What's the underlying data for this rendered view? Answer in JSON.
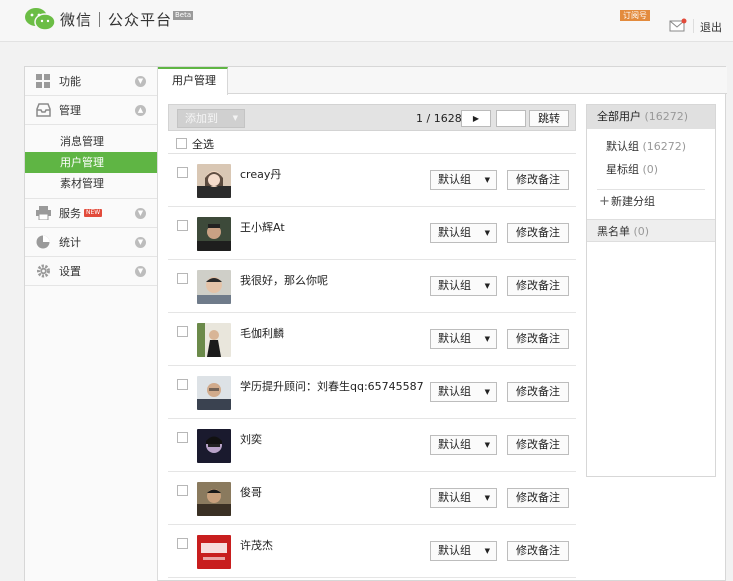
{
  "header": {
    "brand": "微信｜公众平台",
    "beta": "Beta",
    "account_type": "订阅号",
    "logout": "退出"
  },
  "sidebar": {
    "items": [
      {
        "label": "功能",
        "icon": "grid-icon"
      },
      {
        "label": "管理",
        "icon": "inbox-icon"
      },
      {
        "label": "服务",
        "icon": "printer-icon",
        "badge": "NEW"
      },
      {
        "label": "统计",
        "icon": "pie-icon"
      },
      {
        "label": "设置",
        "icon": "gear-icon"
      }
    ],
    "sub_items": [
      {
        "label": "消息管理"
      },
      {
        "label": "用户管理"
      },
      {
        "label": "素材管理"
      }
    ]
  },
  "tabs": [
    {
      "label": "用户管理"
    }
  ],
  "toolbar": {
    "add_to": "添加到",
    "page": "1 / 1628",
    "next": "▶",
    "jump": "跳转"
  },
  "select_all": "全选",
  "users": [
    {
      "name": "creay丹",
      "group": "默认组",
      "note": "修改备注"
    },
    {
      "name": "王小辉At",
      "group": "默认组",
      "note": "修改备注"
    },
    {
      "name": "我很好，那么你呢",
      "group": "默认组",
      "note": "修改备注"
    },
    {
      "name": "毛伽利麟",
      "group": "默认组",
      "note": "修改备注"
    },
    {
      "name": "学历提升顾问：刘春生qq:65745587",
      "group": "默认组",
      "note": "修改备注"
    },
    {
      "name": "刘奕",
      "group": "默认组",
      "note": "修改备注"
    },
    {
      "name": "俊哥",
      "group": "默认组",
      "note": "修改备注"
    },
    {
      "name": "许茂杰",
      "group": "默认组",
      "note": "修改备注"
    }
  ],
  "groups": {
    "all_users": "全部用户",
    "all_count": "(16272)",
    "items": [
      {
        "label": "默认组",
        "count": "(16272)"
      },
      {
        "label": "星标组",
        "count": "(0)"
      }
    ],
    "new_group": "新建分组",
    "blacklist": "黑名单",
    "blacklist_count": "(0)"
  },
  "colors": {
    "accent": "#5fb544",
    "badge": "#e24b3b",
    "subscribe": "#e38b3d"
  }
}
